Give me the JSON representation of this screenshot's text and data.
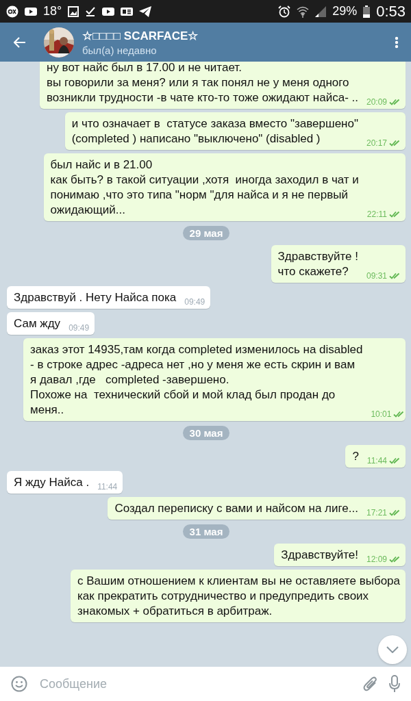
{
  "status_bar": {
    "temperature": "18°",
    "battery": "29%",
    "time": "0:53"
  },
  "header": {
    "title": "☆□□□□ SCARFACE☆",
    "subtitle": "был(а) недавно"
  },
  "messages": [
    {
      "kind": "out",
      "text": "ну вот найс был в 17.00 и не читает.\nвы говорили за меня? или я так понял не у меня одного\nвозникли трудности -в чате кто-то тоже ожидают найса- ..",
      "time": "20:09",
      "read": true
    },
    {
      "kind": "out",
      "text": "и что означает в  статусе заказа вместо \"завершено\"\n(completed ) написано \"выключено\" (disabled )",
      "time": "20:17",
      "read": true
    },
    {
      "kind": "out",
      "text": "был найс и в 21.00\nкак быть? в такой ситуации ,хотя  иногда заходил в чат и\nпонимаю ,что это типа \"норм \"для найса и я не первый\nожидающий...",
      "time": "22:11",
      "read": true
    },
    {
      "kind": "date",
      "text": "29 мая"
    },
    {
      "kind": "out",
      "text": "Здравствуйте !\nчто скажете?",
      "time": "09:31",
      "read": true
    },
    {
      "kind": "in",
      "text": "Здравствуй . Нету Найса пока",
      "time": "09:49"
    },
    {
      "kind": "in",
      "text": "Сам жду",
      "time": "09:49"
    },
    {
      "kind": "out",
      "text": "заказ этот 14935,там когда completed изменилось на disabled\n- в строке адрес -адреса нет ,но у меня же есть скрин и вам\nя давал ,где   completed -завершено.\nПохоже на  технический сбой и мой клад был продан до\nменя..",
      "time": "10:01",
      "read": true
    },
    {
      "kind": "date",
      "text": "30 мая"
    },
    {
      "kind": "out",
      "text": "?",
      "time": "11:44",
      "read": true
    },
    {
      "kind": "in",
      "text": "Я жду Найса .",
      "time": "11:44"
    },
    {
      "kind": "out",
      "text": "Создал переписку с вами и найсом на лиге...",
      "time": "17:21",
      "read": true
    },
    {
      "kind": "date",
      "text": "31 мая"
    },
    {
      "kind": "out",
      "text": "Здравствуйте!",
      "time": "12:09",
      "read": true
    },
    {
      "kind": "out",
      "text": "с Вашим отношением к клиентам вы не оставляете выбора\nкак прекратить сотрудничество и предупредить своих\nзнакомых + обратиться в арбитраж."
    }
  ],
  "composer": {
    "placeholder": "Сообщение"
  }
}
